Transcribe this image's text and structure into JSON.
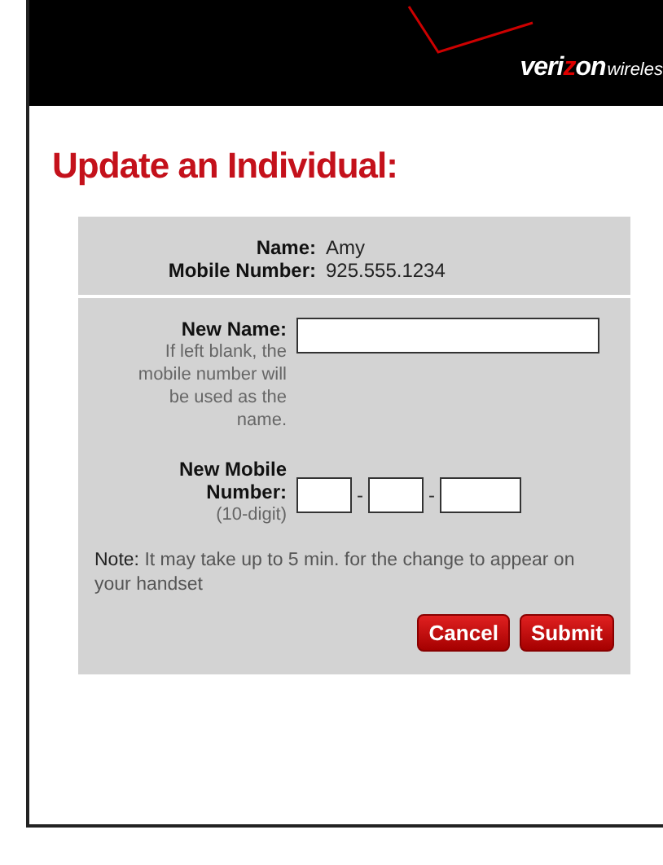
{
  "header": {
    "logo": {
      "prefix": "veri",
      "accent": "z",
      "suffix": "on",
      "tail": "wireles"
    }
  },
  "title": "Update an Individual:",
  "current": [
    {
      "label": "Name:",
      "value": "Amy"
    },
    {
      "label": "Mobile Number:",
      "value": "925.555.1234"
    }
  ],
  "new_name": {
    "label": "New Name:",
    "hint": "If left blank, the mobile number will be used as the name."
  },
  "new_number": {
    "label": "New Mobile Number:",
    "hint": "(10-digit)",
    "separators": [
      "-",
      "-"
    ]
  },
  "note": "**Note:** It may take up to 5 min. for the change to appear on your handset",
  "buttons": [
    "Cancel",
    "Submit"
  ]
}
